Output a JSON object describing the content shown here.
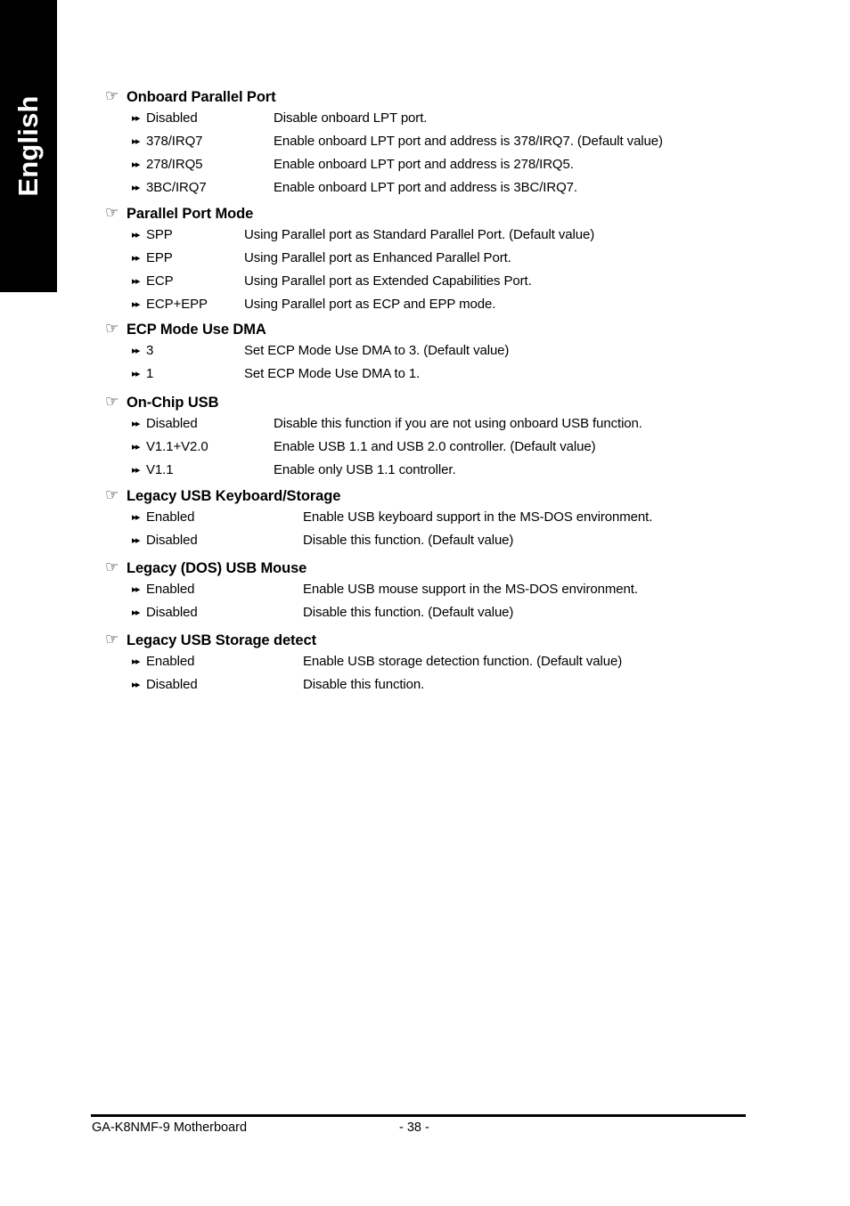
{
  "sidebar": {
    "language_tab": "English",
    "background_color": "#000000",
    "text_color": "#ffffff"
  },
  "icons": {
    "section_pointer": "hand-pointing-right-icon",
    "option_bullet": "double-triangle-right-icon"
  },
  "page": {
    "sections": [
      {
        "title": "Onboard Parallel Port",
        "desc_column": "dcol-a",
        "options": [
          {
            "name": "Disabled",
            "desc": "Disable onboard LPT port."
          },
          {
            "name": "378/IRQ7",
            "desc": "Enable onboard LPT port and address is 378/IRQ7. (Default value)"
          },
          {
            "name": "278/IRQ5",
            "desc": "Enable onboard LPT port and address is 278/IRQ5."
          },
          {
            "name": "3BC/IRQ7",
            "desc": "Enable onboard LPT port and address is 3BC/IRQ7."
          }
        ]
      },
      {
        "title": "Parallel Port Mode",
        "desc_column": "dcol-b",
        "options": [
          {
            "name": "SPP",
            "desc": "Using Parallel port as Standard Parallel Port. (Default value)"
          },
          {
            "name": "EPP",
            "desc": "Using Parallel port as Enhanced Parallel Port."
          },
          {
            "name": "ECP",
            "desc": "Using Parallel port as Extended Capabilities Port."
          },
          {
            "name": "ECP+EPP",
            "desc": "Using Parallel port as ECP and EPP mode."
          }
        ]
      },
      {
        "title": "ECP Mode Use DMA",
        "desc_column": "dcol-b",
        "options": [
          {
            "name": "3",
            "desc": "Set ECP Mode Use DMA to 3. (Default value)"
          },
          {
            "name": "1",
            "desc": "Set ECP Mode Use DMA to 1."
          }
        ]
      },
      {
        "title": "On-Chip USB",
        "desc_column": "dcol-a",
        "options": [
          {
            "name": "Disabled",
            "desc": "Disable this function if you are not using onboard USB function."
          },
          {
            "name": "V1.1+V2.0",
            "desc": "Enable USB 1.1 and USB 2.0 controller. (Default value)"
          },
          {
            "name": "V1.1",
            "desc": "Enable only USB 1.1 controller."
          }
        ]
      },
      {
        "title": "Legacy USB Keyboard/Storage",
        "desc_column": "dcol-c",
        "options": [
          {
            "name": "Enabled",
            "desc": "Enable USB keyboard support in the MS-DOS environment."
          },
          {
            "name": "Disabled",
            "desc": "Disable this function. (Default value)"
          }
        ]
      },
      {
        "title": "Legacy (DOS) USB Mouse",
        "desc_column": "dcol-c",
        "options": [
          {
            "name": "Enabled",
            "desc": "Enable USB mouse support in the MS-DOS environment."
          },
          {
            "name": "Disabled",
            "desc": "Disable this function. (Default value)"
          }
        ]
      },
      {
        "title": "Legacy USB Storage detect",
        "desc_column": "dcol-c",
        "options": [
          {
            "name": "Enabled",
            "desc": "Enable USB storage detection function. (Default value)"
          },
          {
            "name": "Disabled",
            "desc": "Disable this function."
          }
        ]
      }
    ]
  },
  "footer": {
    "product": "GA-K8NMF-9 Motherboard",
    "page_number": "- 38 -"
  }
}
